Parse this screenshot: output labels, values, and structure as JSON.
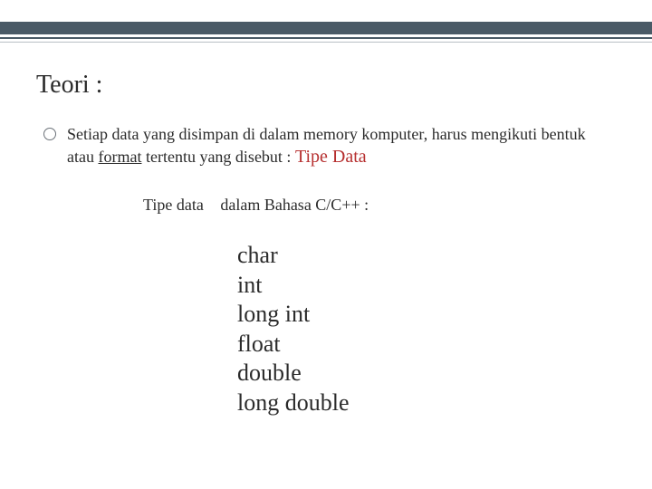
{
  "title": "Teori :",
  "bullet": {
    "lead": "Setiap data yang disimpan di dalam memory komputer, harus mengikuti bentuk atau",
    "underlined_word": "format",
    "tail": "tertentu yang disebut :",
    "emph": "Tipe Data"
  },
  "subrow": {
    "label": "Tipe data",
    "after": "dalam Bahasa C/C++  :"
  },
  "types": [
    "char",
    "int",
    "long int",
    "float",
    "double",
    "long double"
  ]
}
